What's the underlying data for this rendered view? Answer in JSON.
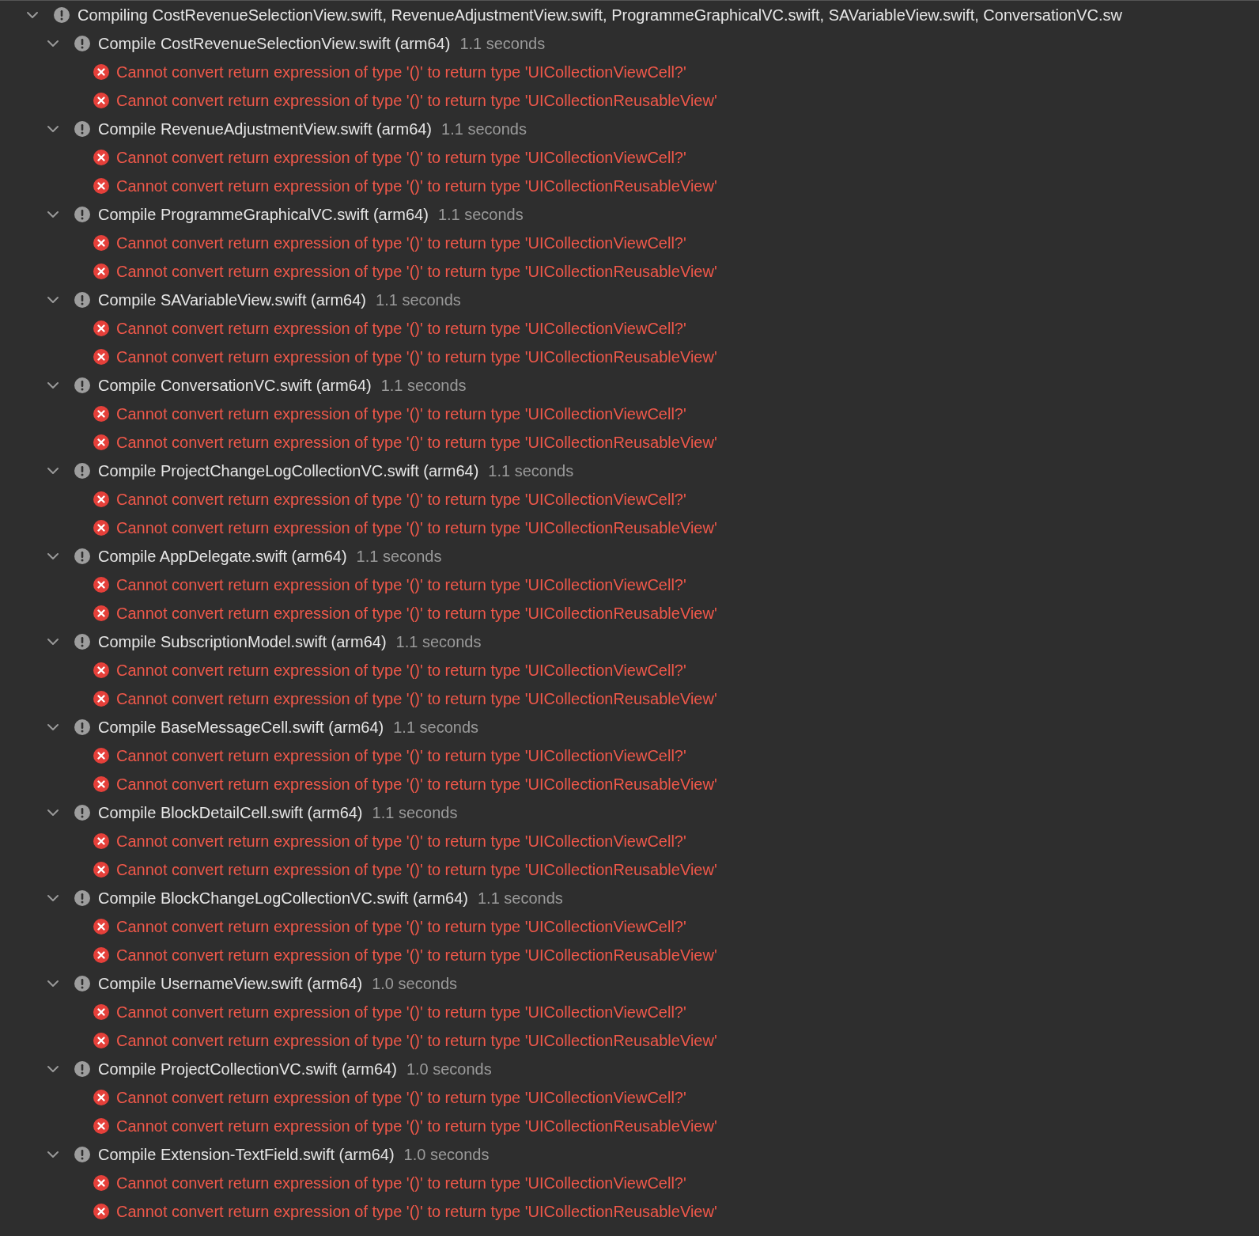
{
  "build_log": {
    "title": "Compiling CostRevenueSelectionView.swift, RevenueAdjustmentView.swift, ProgrammeGraphicalVC.swift, SAVariableView.swift, ConversationVC.sw",
    "expanded": true,
    "children": [
      {
        "title": "Compile CostRevenueSelectionView.swift (arm64)",
        "duration": "1.1 seconds",
        "expanded": true,
        "messages": [
          {
            "kind": "error",
            "text": "Cannot convert return expression of type '()' to return type 'UICollectionViewCell?'"
          },
          {
            "kind": "error",
            "text": "Cannot convert return expression of type '()' to return type 'UICollectionReusableView'"
          }
        ]
      },
      {
        "title": "Compile RevenueAdjustmentView.swift (arm64)",
        "duration": "1.1 seconds",
        "expanded": true,
        "messages": [
          {
            "kind": "error",
            "text": "Cannot convert return expression of type '()' to return type 'UICollectionViewCell?'"
          },
          {
            "kind": "error",
            "text": "Cannot convert return expression of type '()' to return type 'UICollectionReusableView'"
          }
        ]
      },
      {
        "title": "Compile ProgrammeGraphicalVC.swift (arm64)",
        "duration": "1.1 seconds",
        "expanded": true,
        "messages": [
          {
            "kind": "error",
            "text": "Cannot convert return expression of type '()' to return type 'UICollectionViewCell?'"
          },
          {
            "kind": "error",
            "text": "Cannot convert return expression of type '()' to return type 'UICollectionReusableView'"
          }
        ]
      },
      {
        "title": "Compile SAVariableView.swift (arm64)",
        "duration": "1.1 seconds",
        "expanded": true,
        "messages": [
          {
            "kind": "error",
            "text": "Cannot convert return expression of type '()' to return type 'UICollectionViewCell?'"
          },
          {
            "kind": "error",
            "text": "Cannot convert return expression of type '()' to return type 'UICollectionReusableView'"
          }
        ]
      },
      {
        "title": "Compile ConversationVC.swift (arm64)",
        "duration": "1.1 seconds",
        "expanded": true,
        "messages": [
          {
            "kind": "error",
            "text": "Cannot convert return expression of type '()' to return type 'UICollectionViewCell?'"
          },
          {
            "kind": "error",
            "text": "Cannot convert return expression of type '()' to return type 'UICollectionReusableView'"
          }
        ]
      },
      {
        "title": "Compile ProjectChangeLogCollectionVC.swift (arm64)",
        "duration": "1.1 seconds",
        "expanded": true,
        "messages": [
          {
            "kind": "error",
            "text": "Cannot convert return expression of type '()' to return type 'UICollectionViewCell?'"
          },
          {
            "kind": "error",
            "text": "Cannot convert return expression of type '()' to return type 'UICollectionReusableView'"
          }
        ]
      },
      {
        "title": "Compile AppDelegate.swift (arm64)",
        "duration": "1.1 seconds",
        "expanded": true,
        "messages": [
          {
            "kind": "error",
            "text": "Cannot convert return expression of type '()' to return type 'UICollectionViewCell?'"
          },
          {
            "kind": "error",
            "text": "Cannot convert return expression of type '()' to return type 'UICollectionReusableView'"
          }
        ]
      },
      {
        "title": "Compile SubscriptionModel.swift (arm64)",
        "duration": "1.1 seconds",
        "expanded": true,
        "messages": [
          {
            "kind": "error",
            "text": "Cannot convert return expression of type '()' to return type 'UICollectionViewCell?'"
          },
          {
            "kind": "error",
            "text": "Cannot convert return expression of type '()' to return type 'UICollectionReusableView'"
          }
        ]
      },
      {
        "title": "Compile BaseMessageCell.swift (arm64)",
        "duration": "1.1 seconds",
        "expanded": true,
        "messages": [
          {
            "kind": "error",
            "text": "Cannot convert return expression of type '()' to return type 'UICollectionViewCell?'"
          },
          {
            "kind": "error",
            "text": "Cannot convert return expression of type '()' to return type 'UICollectionReusableView'"
          }
        ]
      },
      {
        "title": "Compile BlockDetailCell.swift (arm64)",
        "duration": "1.1 seconds",
        "expanded": true,
        "messages": [
          {
            "kind": "error",
            "text": "Cannot convert return expression of type '()' to return type 'UICollectionViewCell?'"
          },
          {
            "kind": "error",
            "text": "Cannot convert return expression of type '()' to return type 'UICollectionReusableView'"
          }
        ]
      },
      {
        "title": "Compile BlockChangeLogCollectionVC.swift (arm64)",
        "duration": "1.1 seconds",
        "expanded": true,
        "messages": [
          {
            "kind": "error",
            "text": "Cannot convert return expression of type '()' to return type 'UICollectionViewCell?'"
          },
          {
            "kind": "error",
            "text": "Cannot convert return expression of type '()' to return type 'UICollectionReusableView'"
          }
        ]
      },
      {
        "title": "Compile UsernameView.swift (arm64)",
        "duration": "1.0 seconds",
        "expanded": true,
        "messages": [
          {
            "kind": "error",
            "text": "Cannot convert return expression of type '()' to return type 'UICollectionViewCell?'"
          },
          {
            "kind": "error",
            "text": "Cannot convert return expression of type '()' to return type 'UICollectionReusableView'"
          }
        ]
      },
      {
        "title": "Compile ProjectCollectionVC.swift (arm64)",
        "duration": "1.0 seconds",
        "expanded": true,
        "messages": [
          {
            "kind": "error",
            "text": "Cannot convert return expression of type '()' to return type 'UICollectionViewCell?'"
          },
          {
            "kind": "error",
            "text": "Cannot convert return expression of type '()' to return type 'UICollectionReusableView'"
          }
        ]
      },
      {
        "title": "Compile Extension-TextField.swift (arm64)",
        "duration": "1.0 seconds",
        "expanded": true,
        "messages": [
          {
            "kind": "error",
            "text": "Cannot convert return expression of type '()' to return type 'UICollectionViewCell?'"
          },
          {
            "kind": "error",
            "text": "Cannot convert return expression of type '()' to return type 'UICollectionReusableView'"
          }
        ]
      }
    ]
  }
}
